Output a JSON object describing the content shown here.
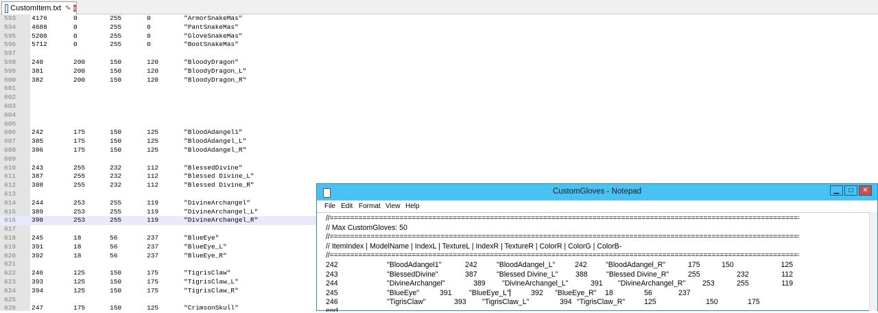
{
  "tab": {
    "filename": "CustomItem.txt",
    "pin_glyph": "✎",
    "close_glyph": "x"
  },
  "editor_lines": [
    {
      "n": "593",
      "c": [
        "4176",
        "0",
        "255",
        "0",
        "\"ArmorSnakeMas\""
      ]
    },
    {
      "n": "594",
      "c": [
        "4688",
        "0",
        "255",
        "0",
        "\"PantSnakeMas\""
      ]
    },
    {
      "n": "595",
      "c": [
        "5200",
        "0",
        "255",
        "0",
        "\"GloveSnakeMas\""
      ]
    },
    {
      "n": "596",
      "c": [
        "5712",
        "0",
        "255",
        "0",
        "\"BootSnakeMas\""
      ]
    },
    {
      "n": "597",
      "c": [
        "",
        "",
        "",
        "",
        ""
      ]
    },
    {
      "n": "598",
      "c": [
        "240",
        "200",
        "150",
        "120",
        "\"BloodyDragon\""
      ]
    },
    {
      "n": "599",
      "c": [
        "381",
        "200",
        "150",
        "120",
        "\"BloodyDragon_L\""
      ]
    },
    {
      "n": "600",
      "c": [
        "382",
        "200",
        "150",
        "120",
        "\"BloodyDragon_R\""
      ]
    },
    {
      "n": "601",
      "c": [
        "",
        "",
        "",
        "",
        ""
      ]
    },
    {
      "n": "602",
      "c": [
        "",
        "",
        "",
        "",
        ""
      ]
    },
    {
      "n": "603",
      "c": [
        "",
        "",
        "",
        "",
        ""
      ]
    },
    {
      "n": "604",
      "c": [
        "",
        "",
        "",
        "",
        ""
      ]
    },
    {
      "n": "605",
      "c": [
        "",
        "",
        "",
        "",
        ""
      ]
    },
    {
      "n": "606",
      "c": [
        "242",
        "175",
        "150",
        "125",
        "\"BloodAdangel1\""
      ]
    },
    {
      "n": "607",
      "c": [
        "385",
        "175",
        "150",
        "125",
        "\"BloodAdangel_L\""
      ]
    },
    {
      "n": "608",
      "c": [
        "386",
        "175",
        "150",
        "125",
        "\"BloodAdangel_R\""
      ]
    },
    {
      "n": "609",
      "c": [
        "",
        "",
        "",
        "",
        ""
      ]
    },
    {
      "n": "610",
      "c": [
        "243",
        "255",
        "232",
        "112",
        "\"BlessedDivine\""
      ]
    },
    {
      "n": "611",
      "c": [
        "387",
        "255",
        "232",
        "112",
        "\"Blessed Divine_L\""
      ]
    },
    {
      "n": "612",
      "c": [
        "388",
        "255",
        "232",
        "112",
        "\"Blessed Divine_R\""
      ]
    },
    {
      "n": "613",
      "c": [
        "",
        "",
        "",
        "",
        ""
      ]
    },
    {
      "n": "614",
      "c": [
        "244",
        "253",
        "255",
        "119",
        "\"DivineArchangel\""
      ]
    },
    {
      "n": "615",
      "c": [
        "389",
        "253",
        "255",
        "119",
        "\"DivineArchangel_L\""
      ]
    },
    {
      "n": "616",
      "c": [
        "390",
        "253",
        "255",
        "119",
        "\"DivineArchangel_R\""
      ],
      "active": true
    },
    {
      "n": "617",
      "c": [
        "",
        "",
        "",
        "",
        ""
      ]
    },
    {
      "n": "618",
      "c": [
        "245",
        "18",
        "56",
        "237",
        "\"BlueEye\""
      ]
    },
    {
      "n": "619",
      "c": [
        "391",
        "18",
        "56",
        "237",
        "\"BlueEye_L\""
      ]
    },
    {
      "n": "620",
      "c": [
        "392",
        "18",
        "56",
        "237",
        "\"BlueEye_R\""
      ]
    },
    {
      "n": "621",
      "c": [
        "",
        "",
        "",
        "",
        ""
      ]
    },
    {
      "n": "622",
      "c": [
        "246",
        "125",
        "150",
        "175",
        "\"TigrisClaw\""
      ]
    },
    {
      "n": "623",
      "c": [
        "393",
        "125",
        "150",
        "175",
        "\"TigrisClaw_L\""
      ]
    },
    {
      "n": "624",
      "c": [
        "394",
        "125",
        "150",
        "175",
        "\"TigrisClaw_R\""
      ]
    },
    {
      "n": "625",
      "c": [
        "",
        "",
        "",
        "",
        ""
      ]
    },
    {
      "n": "626",
      "c": [
        "247",
        "175",
        "150",
        "125",
        "\"CrimsonSkull\""
      ]
    }
  ],
  "notepad": {
    "title": "CustomGloves - Notepad",
    "buttons": {
      "minimize": "▁",
      "maximize": "□",
      "close": "✕"
    },
    "menu": [
      "File",
      "Edit",
      "Format",
      "View",
      "Help"
    ],
    "separator": "//====================================================================================================================================",
    "max_line": "// Max CustomGloves: 50",
    "header_line": "// ItemIndex | ModelName | IndexL | TextureL | IndexR | TextureR | ColorR | ColorG | ColorB-",
    "rows": [
      [
        "242",
        "\"BloodAdangel1\"",
        "242",
        "\"BloodAdangel_L\"",
        "242",
        "\"BloodAdangel_R\"",
        "175",
        "150",
        "125"
      ],
      [
        "243",
        "\"BlessedDivine\"",
        "387",
        "\"Blessed Divine_L\"",
        "388",
        "\"Blessed Divine_R\"",
        "255",
        "232",
        "112"
      ],
      [
        "244",
        "\"DivineArchangel\"",
        "389",
        "\"DivineArchangel_L\"",
        "391",
        "\"DivineArchangel_R\"",
        "253",
        "255",
        "119"
      ],
      [
        "245",
        "\"BlueEye\"",
        "391",
        "\"BlueEye_L\"",
        "392",
        "\"BlueEye_R\"",
        "18",
        "56",
        "237"
      ],
      [
        "246",
        "\"TigrisClaw\"",
        "393",
        "\"TigrisClaw_L\"",
        "394",
        "\"TigrisClaw_R\"",
        "125",
        "150",
        "175"
      ]
    ],
    "end_text": "end"
  }
}
